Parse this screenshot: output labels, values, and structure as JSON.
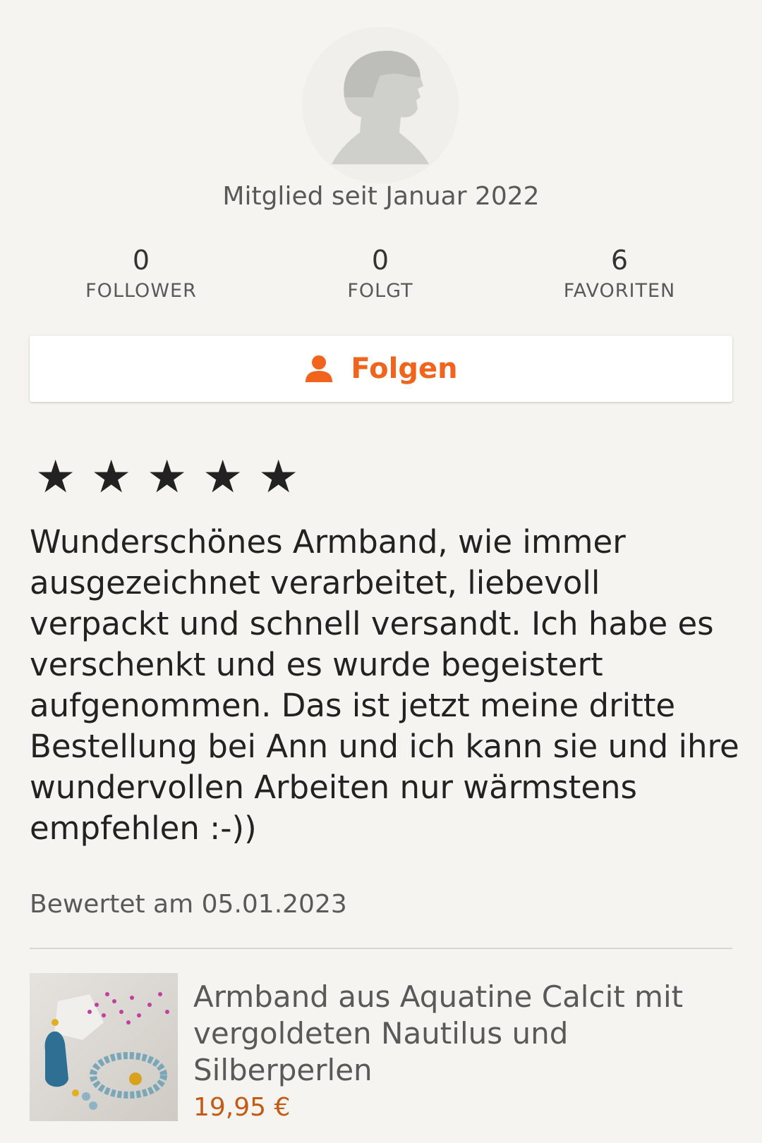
{
  "profile": {
    "avatar_icon": "user-silhouette-icon",
    "member_since": "Mitglied seit Januar 2022"
  },
  "stats": [
    {
      "value": "0",
      "label": "FOLLOWER"
    },
    {
      "value": "0",
      "label": "FOLGT"
    },
    {
      "value": "6",
      "label": "FAVORITEN"
    }
  ],
  "follow_button": {
    "label": "Folgen",
    "icon": "person-icon",
    "color": "#f1641e"
  },
  "review": {
    "rating": 5,
    "max_rating": 5,
    "star_glyph": "★",
    "text": "Wunderschönes Armband, wie immer ausgezeichnet verarbeitet, liebevoll verpackt und schnell versandt. Ich habe es verschenkt und es wurde begeistert aufgenommen. Das ist jetzt meine dritte Bestellung bei Ann und ich kann sie und ihre wundervollen Arbeiten nur wärmstens empfehlen :-))",
    "date": "Bewertet am 05.01.2023"
  },
  "product": {
    "title": "Armband aus Aquatine Calcit mit vergoldeten Nautilus und Silberperlen",
    "price": "19,95 €",
    "price_color": "#c35b15",
    "image_icon": "product-photo-bracelet"
  }
}
